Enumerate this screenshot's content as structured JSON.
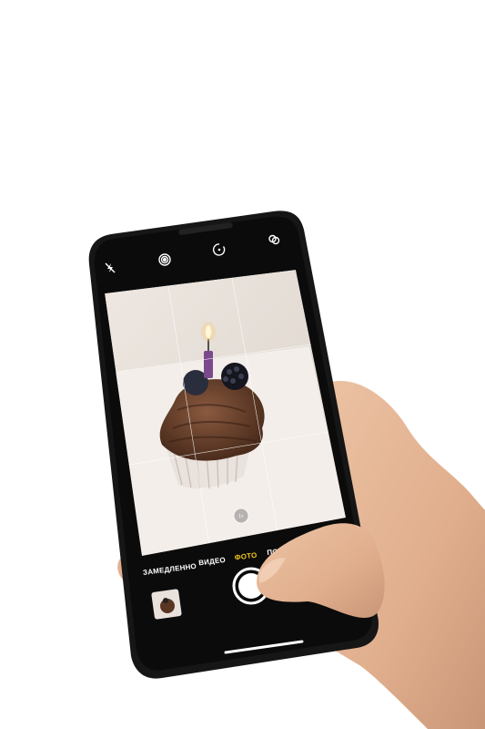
{
  "camera": {
    "modes": [
      {
        "label": "ЗАМЕДЛЕННО",
        "active": false
      },
      {
        "label": "ВИДЕО",
        "active": false
      },
      {
        "label": "ФОТО",
        "active": true
      },
      {
        "label": "ПОРТРЕТ",
        "active": false
      }
    ],
    "zoom_label": "1×",
    "top_icons": [
      "flash-off-icon",
      "live-photo-icon",
      "timer-icon",
      "filters-icon"
    ],
    "accent_color": "#f5c518"
  }
}
